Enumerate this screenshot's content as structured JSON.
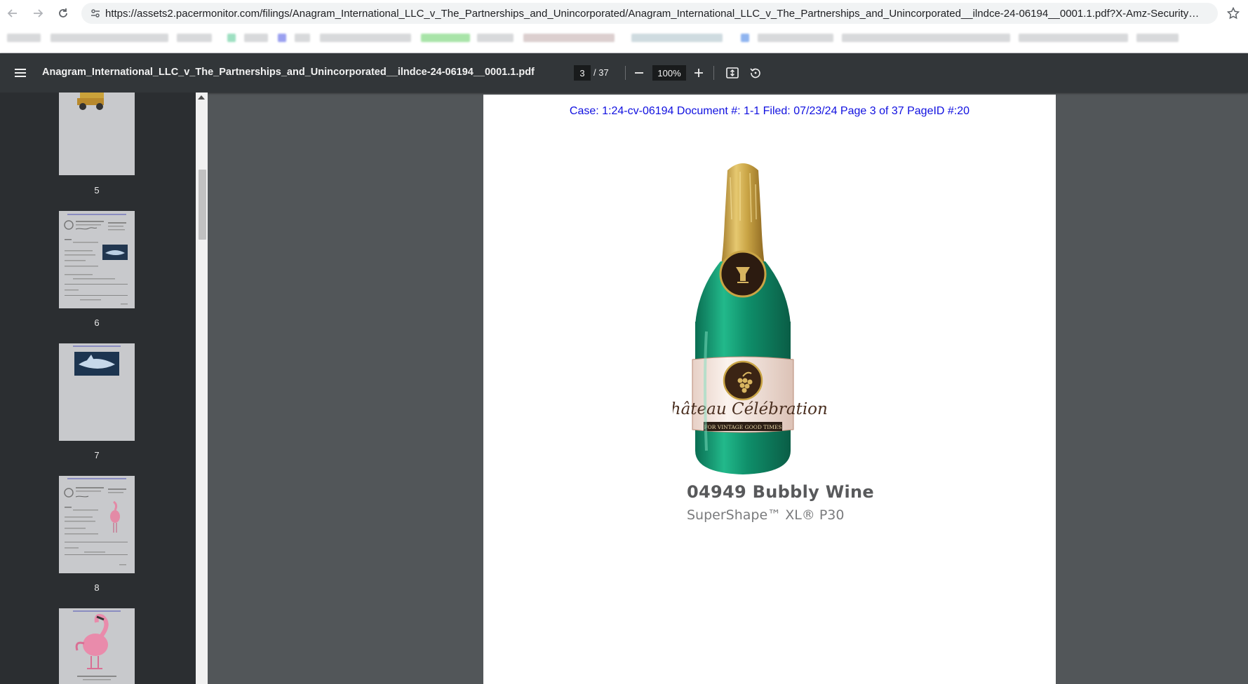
{
  "browser": {
    "url": "https://assets2.pacermonitor.com/filings/Anagram_International_LLC_v_The_Partnerships_and_Unincorporated/Anagram_International_LLC_v_The_Partnerships_and_Unincorporated__ilndce-24-06194__0001.1.pdf?X-Amz-Security-Token=..."
  },
  "viewer": {
    "title": "Anagram_International_LLC_v_The_Partnerships_and_Unincorporated__ilndce-24-06194__0001.1.pdf",
    "current_page": "3",
    "total_pages": "/ 37",
    "zoom": "100%"
  },
  "sidebar": {
    "thumbnails": [
      {
        "label": "5"
      },
      {
        "label": "6"
      },
      {
        "label": "7"
      },
      {
        "label": "8"
      }
    ]
  },
  "page": {
    "header": "Case: 1:24-cv-06194 Document #: 1-1 Filed: 07/23/24 Page 3 of 37 PageID #:20",
    "product_code": "04949 Bubbly Wine",
    "product_line": "SuperShape™ XL® P30",
    "label_brand": "Château Célébration",
    "label_tagline": "FOR VINTAGE GOOD TIMES"
  },
  "colors": {
    "toolbar": "#323639",
    "sidebar": "#2b2e31",
    "viewer_bg": "#525659",
    "header_text": "#1010e0",
    "bottle_green": "#0f8f6a",
    "foil_gold": "#c9a445"
  }
}
